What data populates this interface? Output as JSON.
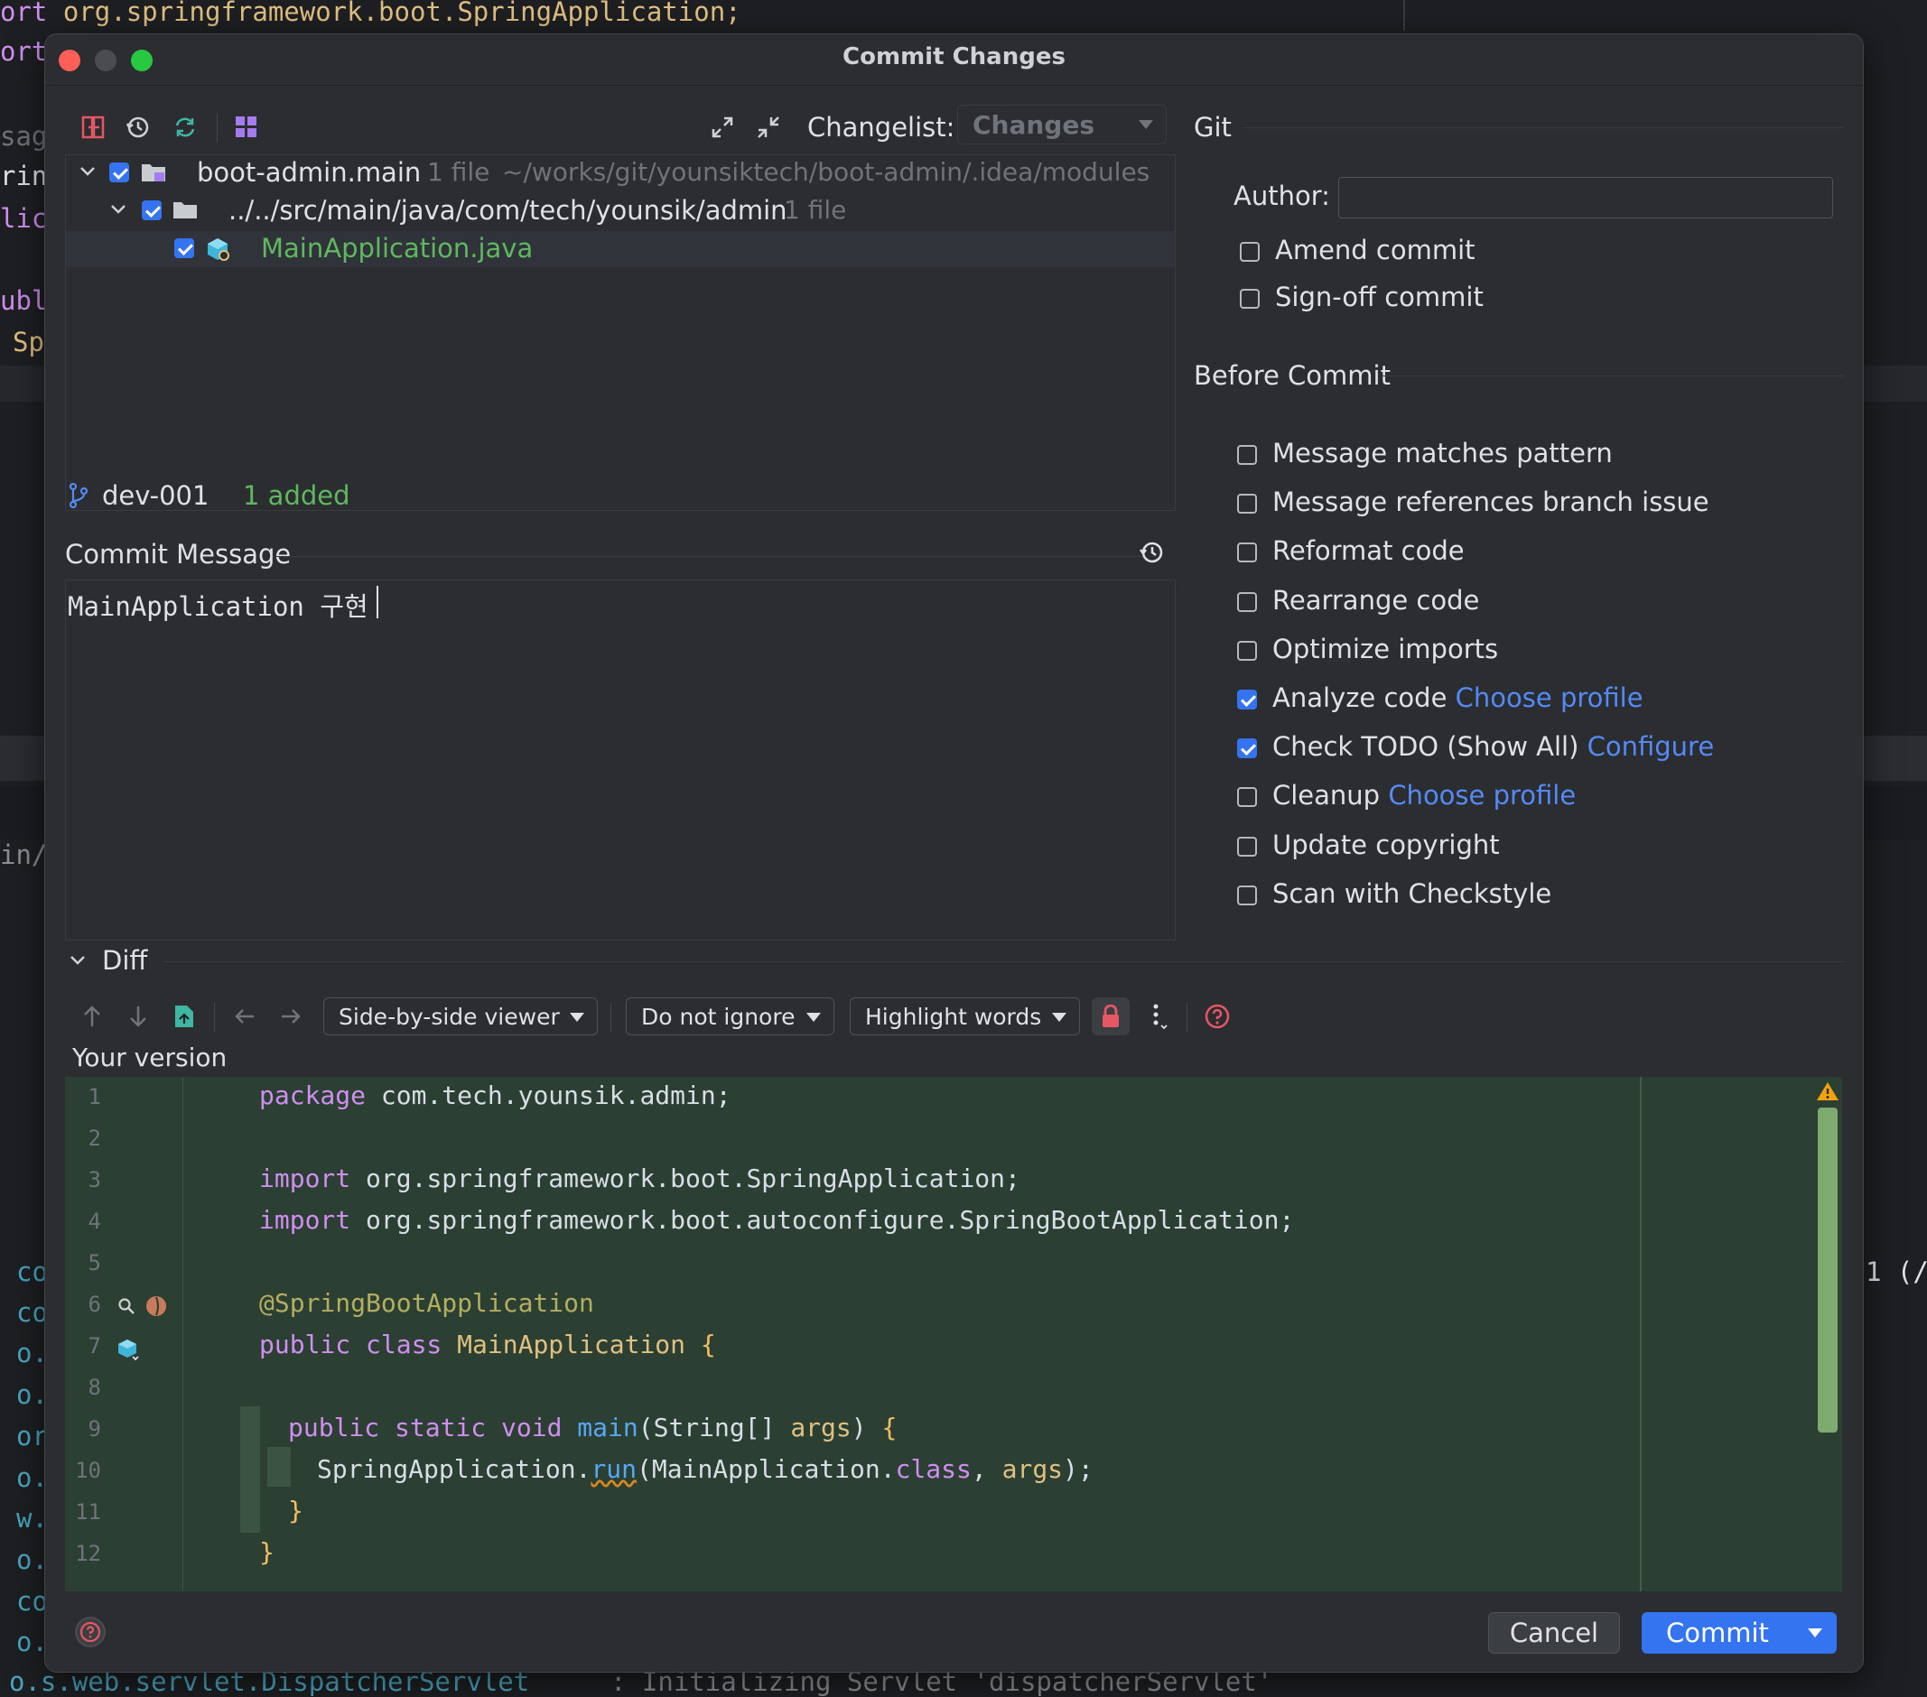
{
  "background_editor": {
    "top_line": "ort org.springframework.boot.SpringApplication;",
    "line2_prefix": "ort",
    "left_fragments": [
      "sag",
      "rin",
      "lic",
      "ubl",
      "Sp",
      "in/",
      "co",
      "co",
      "o.",
      "o.",
      "or",
      "o.",
      "w.",
      "o.",
      "co",
      "o."
    ],
    "right_fragment": "1 (/",
    "bottom_line_left": "o.s.web.servlet.DispatcherServlet",
    "bottom_line_right": ": Initializing Servlet 'dispatcherServlet'"
  },
  "dialog": {
    "title": "Commit Changes",
    "toolbar": {
      "changelist_label": "Changelist:",
      "changelist_value": "Changes"
    },
    "tree": {
      "module": {
        "name": "boot-admin.main",
        "count": "1 file",
        "path": "~/works/git/younsiktech/boot-admin/.idea/modules"
      },
      "folder": {
        "path": "../../src/main/java/com/tech/younsik/admin",
        "count": "1 file"
      },
      "file": {
        "name": "MainApplication.java"
      }
    },
    "status": {
      "branch": "dev-001",
      "added": "1 added"
    },
    "commit_message": {
      "label": "Commit Message",
      "text": "MainApplication 구현"
    },
    "git": {
      "section": "Git",
      "author_label": "Author:",
      "author_value": "",
      "amend": "Amend commit",
      "signoff": "Sign-off commit"
    },
    "before_commit": {
      "section": "Before Commit",
      "options": [
        {
          "label": "Message matches pattern",
          "checked": false,
          "link": ""
        },
        {
          "label": "Message references branch issue",
          "checked": false,
          "link": ""
        },
        {
          "label": "Reformat code",
          "checked": false,
          "link": ""
        },
        {
          "label": "Rearrange code",
          "checked": false,
          "link": ""
        },
        {
          "label": "Optimize imports",
          "checked": false,
          "link": ""
        },
        {
          "label": "Analyze code",
          "checked": true,
          "link": "Choose profile"
        },
        {
          "label": "Check TODO (Show All)",
          "checked": true,
          "link": "Configure"
        },
        {
          "label": "Cleanup",
          "checked": false,
          "link": "Choose profile"
        },
        {
          "label": "Update copyright",
          "checked": false,
          "link": ""
        },
        {
          "label": "Scan with Checkstyle",
          "checked": false,
          "link": ""
        }
      ]
    },
    "diff": {
      "section": "Diff",
      "viewer": "Side-by-side viewer",
      "ignore": "Do not ignore",
      "highlight": "Highlight words",
      "your_version": "Your version",
      "line_numbers": [
        "1",
        "2",
        "3",
        "4",
        "5",
        "6",
        "7",
        "8",
        "9",
        "10",
        "11",
        "12"
      ]
    },
    "buttons": {
      "cancel": "Cancel",
      "commit": "Commit"
    }
  },
  "colors": {
    "accent": "#3574f0",
    "link": "#548af7",
    "added_green": "#5fb85f",
    "diff_bg": "#2c3f33",
    "error_red": "#e55765"
  }
}
